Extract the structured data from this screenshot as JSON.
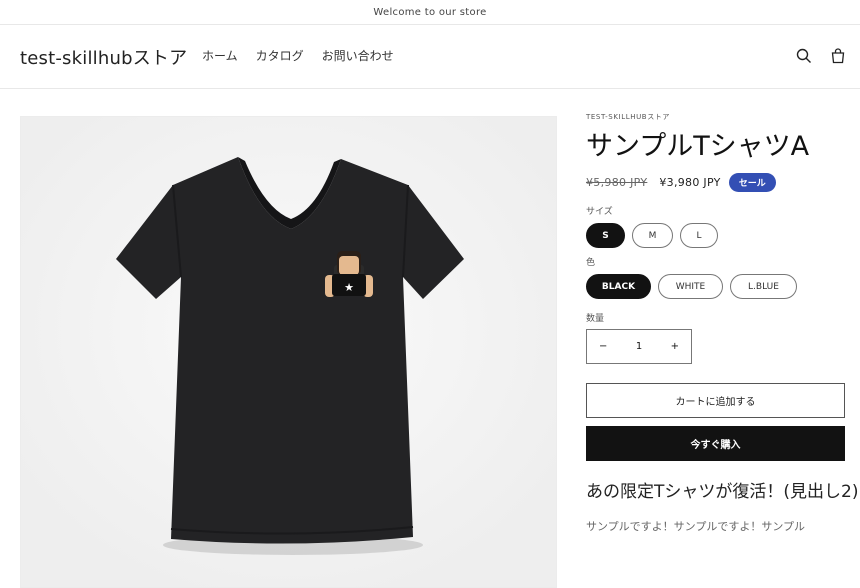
{
  "announcement": "Welcome to our store",
  "header": {
    "logo": "test-skillhubストア",
    "nav": [
      "ホーム",
      "カタログ",
      "お問い合わせ"
    ]
  },
  "product": {
    "vendor": "TEST-SKILLHUBストア",
    "title": "サンプルTシャツA",
    "compare_price": "¥5,980 JPY",
    "price": "¥3,980 JPY",
    "sale_badge": "セール",
    "size_label": "サイズ",
    "sizes": [
      "S",
      "M",
      "L"
    ],
    "color_label": "色",
    "colors": [
      "BLACK",
      "WHITE",
      "L.BLUE"
    ],
    "quantity_label": "数量",
    "quantity": {
      "minus": "−",
      "value": "1",
      "plus": "+"
    },
    "add_to_cart": "カートに追加する",
    "buy_now": "今すぐ購入",
    "description_heading": "あの限定Tシャツが復活！(見出し2)",
    "description_text": "サンプルですよ！サンプルですよ！サンプル"
  },
  "colors": {
    "accent_badge": "#334fb4",
    "selected": "#121212"
  }
}
